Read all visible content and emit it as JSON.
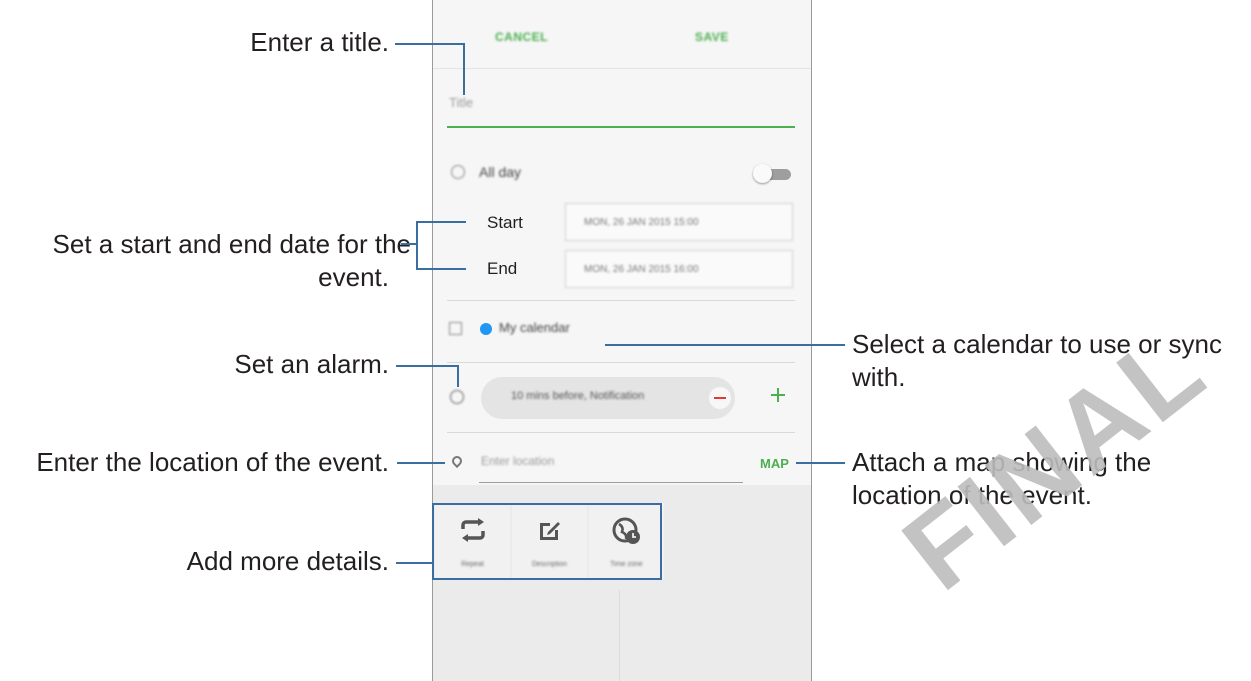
{
  "topbar": {
    "cancel_label": "CANCEL",
    "save_label": "SAVE"
  },
  "title_field": {
    "placeholder": "Title"
  },
  "all_day": {
    "label": "All day",
    "toggle_on": false
  },
  "start": {
    "label": "Start",
    "value": "MON, 26 JAN 2015   15:00"
  },
  "end": {
    "label": "End",
    "value": "MON, 26 JAN 2015   16:00"
  },
  "calendar": {
    "name": "My calendar",
    "dot_color": "#2196f3"
  },
  "alarm": {
    "value": "10 mins before, Notification"
  },
  "location": {
    "placeholder": "Enter location",
    "map_label": "MAP"
  },
  "details": [
    {
      "label": "Repeat",
      "icon": "repeat-icon"
    },
    {
      "label": "Description",
      "icon": "edit-icon"
    },
    {
      "label": "Time zone",
      "icon": "globe-clock-icon"
    }
  ],
  "callouts": {
    "title": "Enter a title.",
    "dates_line1": "Set a start and end date for the",
    "dates_line2": "event.",
    "alarm": "Set an alarm.",
    "location": "Enter the location of the event.",
    "details": "Add more details.",
    "calendar_line1": "Select a calendar to use or sync",
    "calendar_line2": "with.",
    "map_line1": "Attach a map showing the",
    "map_line2": "location of the event."
  },
  "colors": {
    "accent": "#4caf50",
    "callout_line": "#3b6ea0",
    "remove": "#e53935"
  },
  "watermark": "FINAL"
}
